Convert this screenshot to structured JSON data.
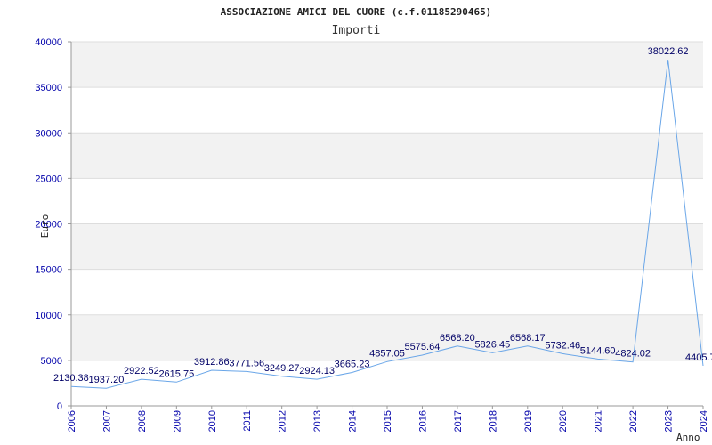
{
  "chart_data": {
    "type": "line",
    "title": "ASSOCIAZIONE AMICI DEL CUORE (c.f.01185290465)",
    "subtitle": "Importi",
    "xlabel": "Anno",
    "ylabel": "Euro",
    "categories": [
      "2006",
      "2007",
      "2008",
      "2009",
      "2010",
      "2011",
      "2012",
      "2013",
      "2014",
      "2015",
      "2016",
      "2017",
      "2018",
      "2019",
      "2020",
      "2021",
      "2022",
      "2023",
      "2024"
    ],
    "series": [
      {
        "values": [
          2130.38,
          1937.2,
          2922.52,
          2615.75,
          3912.86,
          3771.56,
          3249.27,
          2924.13,
          3665.23,
          4857.05,
          5575.64,
          6568.2,
          5826.45,
          6568.17,
          5732.46,
          5144.6,
          4824.02,
          38022.62,
          4405.7
        ],
        "labels": [
          "2130.38",
          "1937.20",
          "2922.52",
          "2615.75",
          "3912.86",
          "3771.56",
          "3249.27",
          "2924.13",
          "3665.23",
          "4857.05",
          "5575.64",
          "6568.20",
          "5826.45",
          "6568.17",
          "5732.46",
          "5144.60",
          "4824.02",
          "38022.62",
          "4405.7"
        ]
      }
    ],
    "ylim": [
      0,
      40000
    ],
    "yticks": [
      "0",
      "5000",
      "10000",
      "15000",
      "20000",
      "25000",
      "30000",
      "35000",
      "40000"
    ],
    "grid": true,
    "colors": {
      "line": "#6aa6e8",
      "band": "#f2f2f2",
      "tick_text": "#0000aa",
      "label_text": "#000066"
    }
  }
}
